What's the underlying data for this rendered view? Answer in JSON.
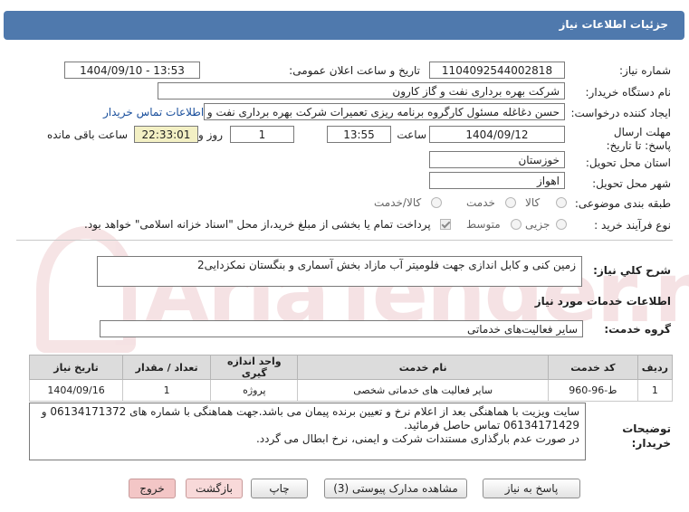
{
  "header": {
    "title": "جزئیات اطلاعات نیاز"
  },
  "labels": {
    "need_number": "شماره نیاز:",
    "announce_datetime": "تاریخ و ساعت اعلان عمومی:",
    "buyer_org": "نام دستگاه خریدار:",
    "requester": "ایجاد کننده درخواست:",
    "deadline": "مهلت ارسال پاسخ: تا تاریخ:",
    "time": "ساعت",
    "day_and": "روز و",
    "remaining": "ساعت باقی مانده",
    "province": "استان محل تحویل:",
    "city": "شهر محل تحویل:",
    "category": "طبقه بندی موضوعی:",
    "purchase_type": "نوع فرآیند خرید :",
    "need_summary": "شرح کلي نياز:",
    "services_info": "اطلاعات خدمات مورد نیاز",
    "service_group": "گروه خدمت:",
    "buyer_notes": "توضیحات خریدار:"
  },
  "values": {
    "need_number": "1104092544002818",
    "announce_datetime": "1404/09/10 - 13:53",
    "buyer_org": "شرکت بهره برداری نفت و گاز کارون",
    "requester": "حسن دغاغله مسئول کارگروه برنامه ریزی تعمیرات شرکت بهره برداری نفت و گاز",
    "contact_link": "اطلاعات تماس خریدار",
    "deadline_date": "1404/09/12",
    "deadline_time": "13:55",
    "days": "1",
    "remaining_time": "22:33:01",
    "province": "خوزستان",
    "city": "اهواز",
    "need_summary": "زمین کنی و کابل اندازی جهت فلومیتر آب مازاد بخش آسماری و بنگستان نمکزدایی2",
    "service_group": "سایر فعالیت‌های خدماتی"
  },
  "category_options": [
    "کالا",
    "خدمت",
    "کالا/خدمت"
  ],
  "purchase_options": [
    "جزیی",
    "متوسط"
  ],
  "purchase_note": "پرداخت تمام یا بخشی از مبلغ خرید،از محل \"اسناد خزانه اسلامی\" خواهد بود.",
  "table": {
    "headers": [
      "ردیف",
      "کد خدمت",
      "نام خدمت",
      "واحد اندازه گیری",
      "تعداد / مقدار",
      "تاریخ نیاز"
    ],
    "rows": [
      [
        "1",
        "ط-96-960",
        "سایر فعالیت های خدماتی شخصی",
        "پروژه",
        "1",
        "1404/09/16"
      ]
    ]
  },
  "notes": [
    "سایت ویزیت با هماهنگی بعد از اعلام نرخ و تعیین برنده پیمان می باشد.جهت هماهنگی با شماره های  06134171372 و",
    "06134171429 تماس حاصل فرمائید.",
    "در صورت عدم بارگذاری مستندات شرکت و ایمنی، نرخ ابطال می گردد."
  ],
  "buttons": {
    "reply": "پاسخ به نیاز",
    "attachments": "مشاهده مدارک پیوستی (3)",
    "print": "چاپ",
    "back": "بازگشت",
    "exit": "خروج"
  },
  "watermark": "AriaTender.neT",
  "colors": {
    "header_bg": "#4f79ad",
    "remaining_bg": "#f3f0c4",
    "link": "#1a4f9c"
  }
}
